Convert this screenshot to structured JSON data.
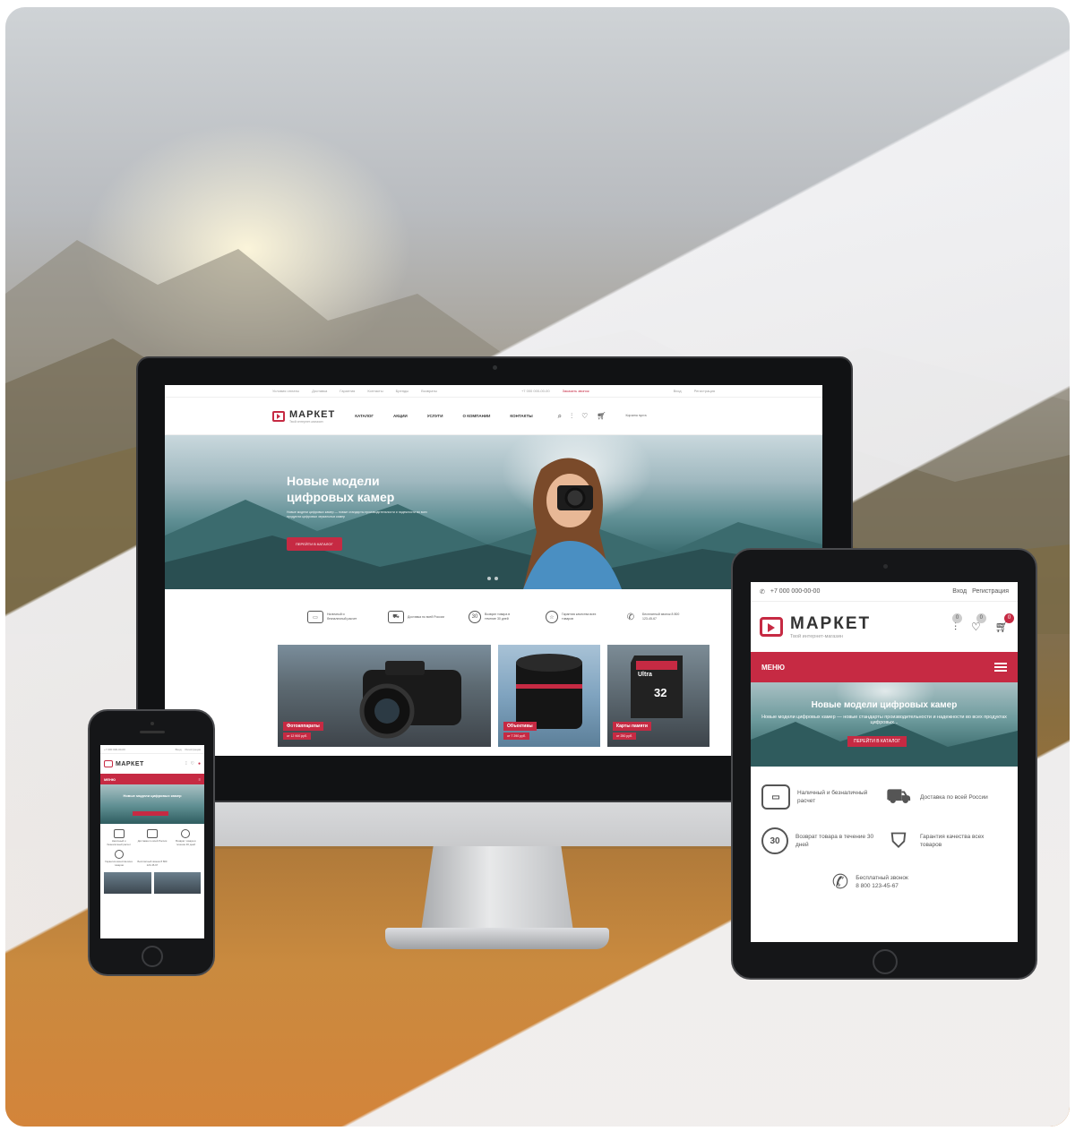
{
  "colors": {
    "accent": "#c62a43",
    "text": "#333333"
  },
  "desktop": {
    "topbar": {
      "links": [
        "Условия оплаты",
        "Доставка",
        "Гарантия",
        "Контакты",
        "Бренды",
        "Возвраты"
      ],
      "phone": "+7 000 000-00-00",
      "callback": "Заказать звонок",
      "login": "Вход",
      "register": "Регистрация"
    },
    "logo": {
      "name": "МАРКЕТ",
      "tagline": "Твой интернет-магазин"
    },
    "nav": [
      "КАТАЛОГ",
      "АКЦИИ",
      "УСЛУГИ",
      "О КОМПАНИИ",
      "КОНТАКТЫ"
    ],
    "cart_label": "Корзина пуста",
    "hero": {
      "title": "Новые модели цифровых камер",
      "text": "Новые модели цифровых камер — новые стандарты производительности и надежности во всех продуктах цифровых зеркальных камер",
      "button": "ПЕРЕЙТИ В КАТАЛОГ"
    },
    "features": [
      {
        "icon": "wallet-icon",
        "text": "Наличный и безналичный расчет"
      },
      {
        "icon": "truck-icon",
        "text": "Доставка по всей России"
      },
      {
        "icon": "return-30-icon",
        "text": "Возврат товара в течение 30 дней"
      },
      {
        "icon": "shield-star-icon",
        "text": "Гарантия качества всех товаров"
      },
      {
        "icon": "phone-icon",
        "text": "Бесплатный звонок 8 800 123-45-67"
      }
    ],
    "tiles": [
      {
        "label": "Фотоаппараты",
        "price": "от 12 900 руб."
      },
      {
        "label": "Объективы",
        "price": "от 7 290 руб."
      },
      {
        "label": "Карты памяти",
        "price": "от 250 руб."
      }
    ],
    "sd_card": {
      "brand": "Ultra",
      "size": "32"
    }
  },
  "tablet": {
    "phone": "+7 000 000-00-00",
    "login": "Вход",
    "register": "Регистрация",
    "logo": {
      "name": "МАРКЕТ",
      "tagline": "Твой интернет-магазин"
    },
    "badges": {
      "compare": "0",
      "favorites": "0",
      "cart": "0"
    },
    "menu": "МЕНЮ",
    "hero": {
      "title": "Новые модели цифровых камер",
      "text": "Новые модели цифровых камер — новые стандарты производительности и надежности во всех продуктах цифровых...",
      "button": "ПЕРЕЙТИ В КАТАЛОГ"
    },
    "features": [
      {
        "icon": "wallet-icon",
        "text": "Наличный и безналичный расчет"
      },
      {
        "icon": "truck-icon",
        "text": "Доставка по всей России"
      },
      {
        "icon": "return-30-icon",
        "badge": "30",
        "text": "Возврат товара в течение 30 дней"
      },
      {
        "icon": "shield-star-icon",
        "text": "Гарантия качества всех товаров"
      }
    ],
    "call": {
      "title": "Бесплатный звонок",
      "number": "8 800 123-45-67"
    }
  },
  "phone": {
    "phone": "+7 000 000-00-00",
    "login": "Вход",
    "register": "Регистрация",
    "logo": "МАРКЕТ",
    "menu": "МЕНЮ",
    "hero_title": "Новые модели цифровых камер",
    "features": [
      "Наличный и безналичный расчет",
      "Доставка по всей России",
      "Возврат товара в течение 30 дней",
      "Гарантия качества всех товаров",
      "Бесплатный звонок 8 800 123-45-67"
    ]
  }
}
